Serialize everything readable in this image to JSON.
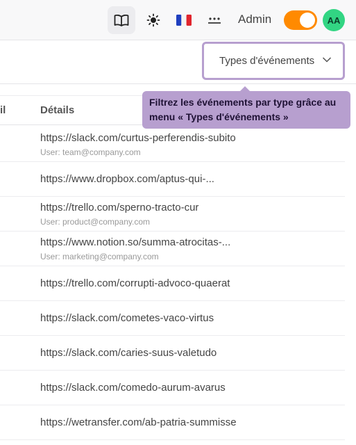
{
  "topbar": {
    "admin_label": "Admin",
    "avatar_initials": "AA",
    "toggle_color": "#ff8a00",
    "avatar_color": "#32d583",
    "icons": [
      "book-icon",
      "sun-icon",
      "flag-fr-icon",
      "password-dots-icon"
    ]
  },
  "filter": {
    "type_select_label": "Types d'événements"
  },
  "tooltip": {
    "text": "Filtrez les événements par type grâce au menu « Types d'événements »",
    "color": "#b79fcf"
  },
  "table": {
    "cut_header": "il",
    "details_header": "Détails",
    "rows": [
      {
        "url": "https://slack.com/curtus-perferendis-subito",
        "user": "User: team@company.com"
      },
      {
        "url": "https://www.dropbox.com/aptus-qui-...",
        "user": ""
      },
      {
        "url": "https://trello.com/sperno-tracto-cur",
        "user": "User: product@company.com"
      },
      {
        "url": "https://www.notion.so/summa-atrocitas-...",
        "user": "User: marketing@company.com"
      },
      {
        "url": "https://trello.com/corrupti-advoco-quaerat",
        "user": ""
      },
      {
        "url": "https://slack.com/cometes-vaco-virtus",
        "user": ""
      },
      {
        "url": "https://slack.com/caries-suus-valetudo",
        "user": ""
      },
      {
        "url": "https://slack.com/comedo-aurum-avarus",
        "user": ""
      },
      {
        "url": "https://wetransfer.com/ab-patria-summisse",
        "user": ""
      }
    ]
  }
}
